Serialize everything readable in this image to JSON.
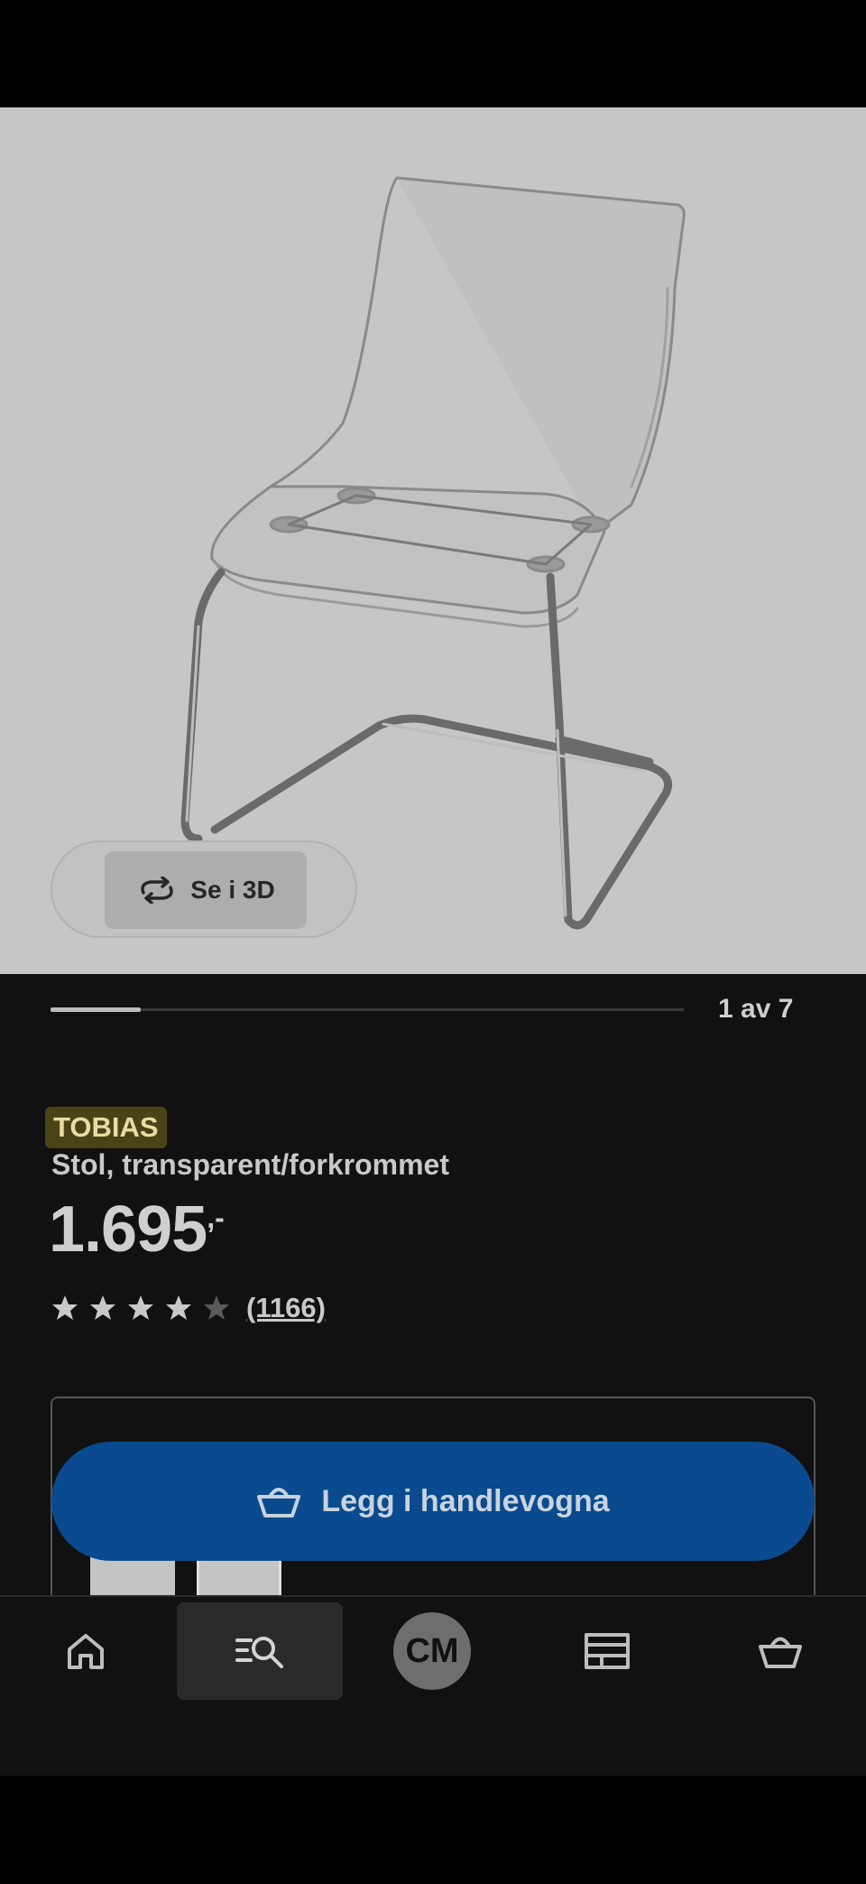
{
  "gallery": {
    "view_3d_label": "Se i 3D",
    "image_counter": "1 av 7",
    "progress_fraction": 0.143
  },
  "product": {
    "brand": "TOBIAS",
    "description": "Stol, transparent/forkrommet",
    "price_main": "1.695",
    "price_suffix": ",-",
    "rating_value": 4,
    "rating_max": 5,
    "rating_count": "(1166)"
  },
  "cart": {
    "add_label": "Legg i handlevogna"
  },
  "bottom_nav": {
    "items": [
      "home-icon",
      "search-icon",
      "avatar",
      "store-icon",
      "cart-icon"
    ],
    "avatar_initials": "CM",
    "active_index": 1
  },
  "colors": {
    "accent": "#0a4a8f",
    "brand_bg": "#4a4318",
    "brand_text": "#e9dca0"
  }
}
